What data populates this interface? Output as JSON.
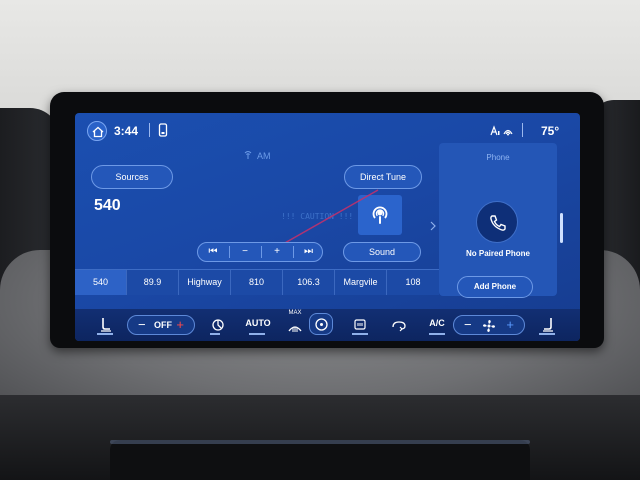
{
  "status_bar": {
    "time": "3:44",
    "temperature": "75°"
  },
  "audio": {
    "band": "AM",
    "sources_label": "Sources",
    "direct_tune_label": "Direct Tune",
    "station": "540",
    "sound_label": "Sound",
    "tune_controls": [
      "⏮",
      "−",
      "+",
      "⏭"
    ],
    "background_text": "!!! CAUTION !!!"
  },
  "presets": [
    "540",
    "89.9",
    "Highway",
    "810",
    "106.3",
    "Margvile",
    "108"
  ],
  "active_preset_index": 0,
  "phone": {
    "title": "Phone",
    "status": "No Paired Phone",
    "add_label": "Add Phone"
  },
  "climate": {
    "fan_label": "OFF",
    "auto_label": "AUTO",
    "max_label": "MAX",
    "ac_label": "A/C"
  },
  "colors": {
    "screen_bg": "#1a48a6",
    "accent_red": "#ff4a4a",
    "accent_blue": "#5a9bff"
  },
  "icons": {
    "home": "home-icon",
    "phone_status": "phone-status-icon",
    "wireless": "wireless-charging-icon",
    "wifi": "wifi-icon",
    "podcast": "podcast-icon",
    "phone": "phone-icon",
    "seat_heat": "seat-heat-icon",
    "fan": "fan-icon",
    "defrost": "defrost-icon",
    "steering_heat": "steering-heat-icon",
    "recirc": "recirculation-icon"
  }
}
